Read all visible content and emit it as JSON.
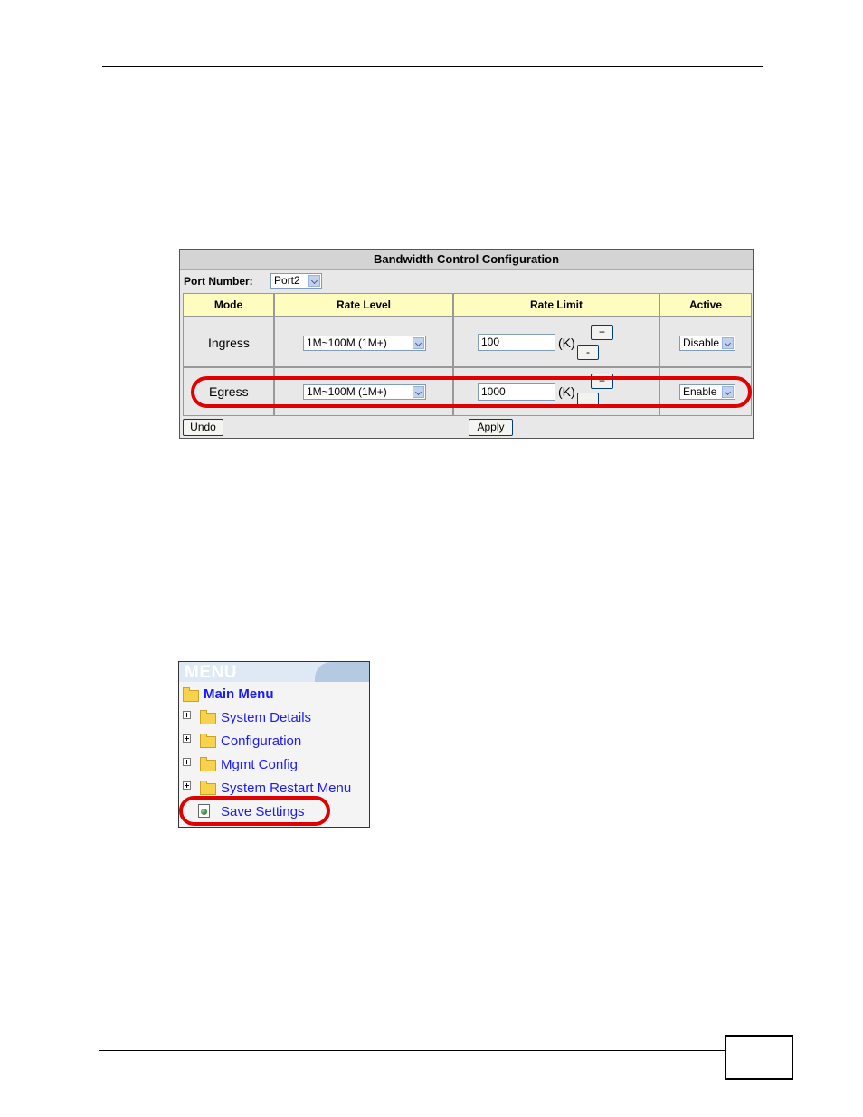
{
  "bandwidth": {
    "title": "Bandwidth Control Configuration",
    "port_label": "Port Number:",
    "port_value": "Port2",
    "headers": [
      "Mode",
      "Rate Level",
      "Rate Limit",
      "Active"
    ],
    "rows": [
      {
        "mode": "Ingress",
        "rate_level": "1M~100M (1M+)",
        "rate_limit": "100",
        "unit": "(K)",
        "plus": "+",
        "minus": "-",
        "active": "Disable"
      },
      {
        "mode": "Egress",
        "rate_level": "1M~100M (1M+)",
        "rate_limit": "1000",
        "unit": "(K)",
        "plus": "+",
        "minus": "",
        "active": "Enable"
      }
    ],
    "undo_label": "Undo",
    "apply_label": "Apply",
    "highlight_color": "#e00000"
  },
  "menu": {
    "title": "MENU",
    "main": "Main Menu",
    "items": [
      "System Details",
      "Configuration",
      "Mgmt Config",
      "System Restart Menu",
      "Save Settings"
    ],
    "link_color": "#1a1aff"
  }
}
